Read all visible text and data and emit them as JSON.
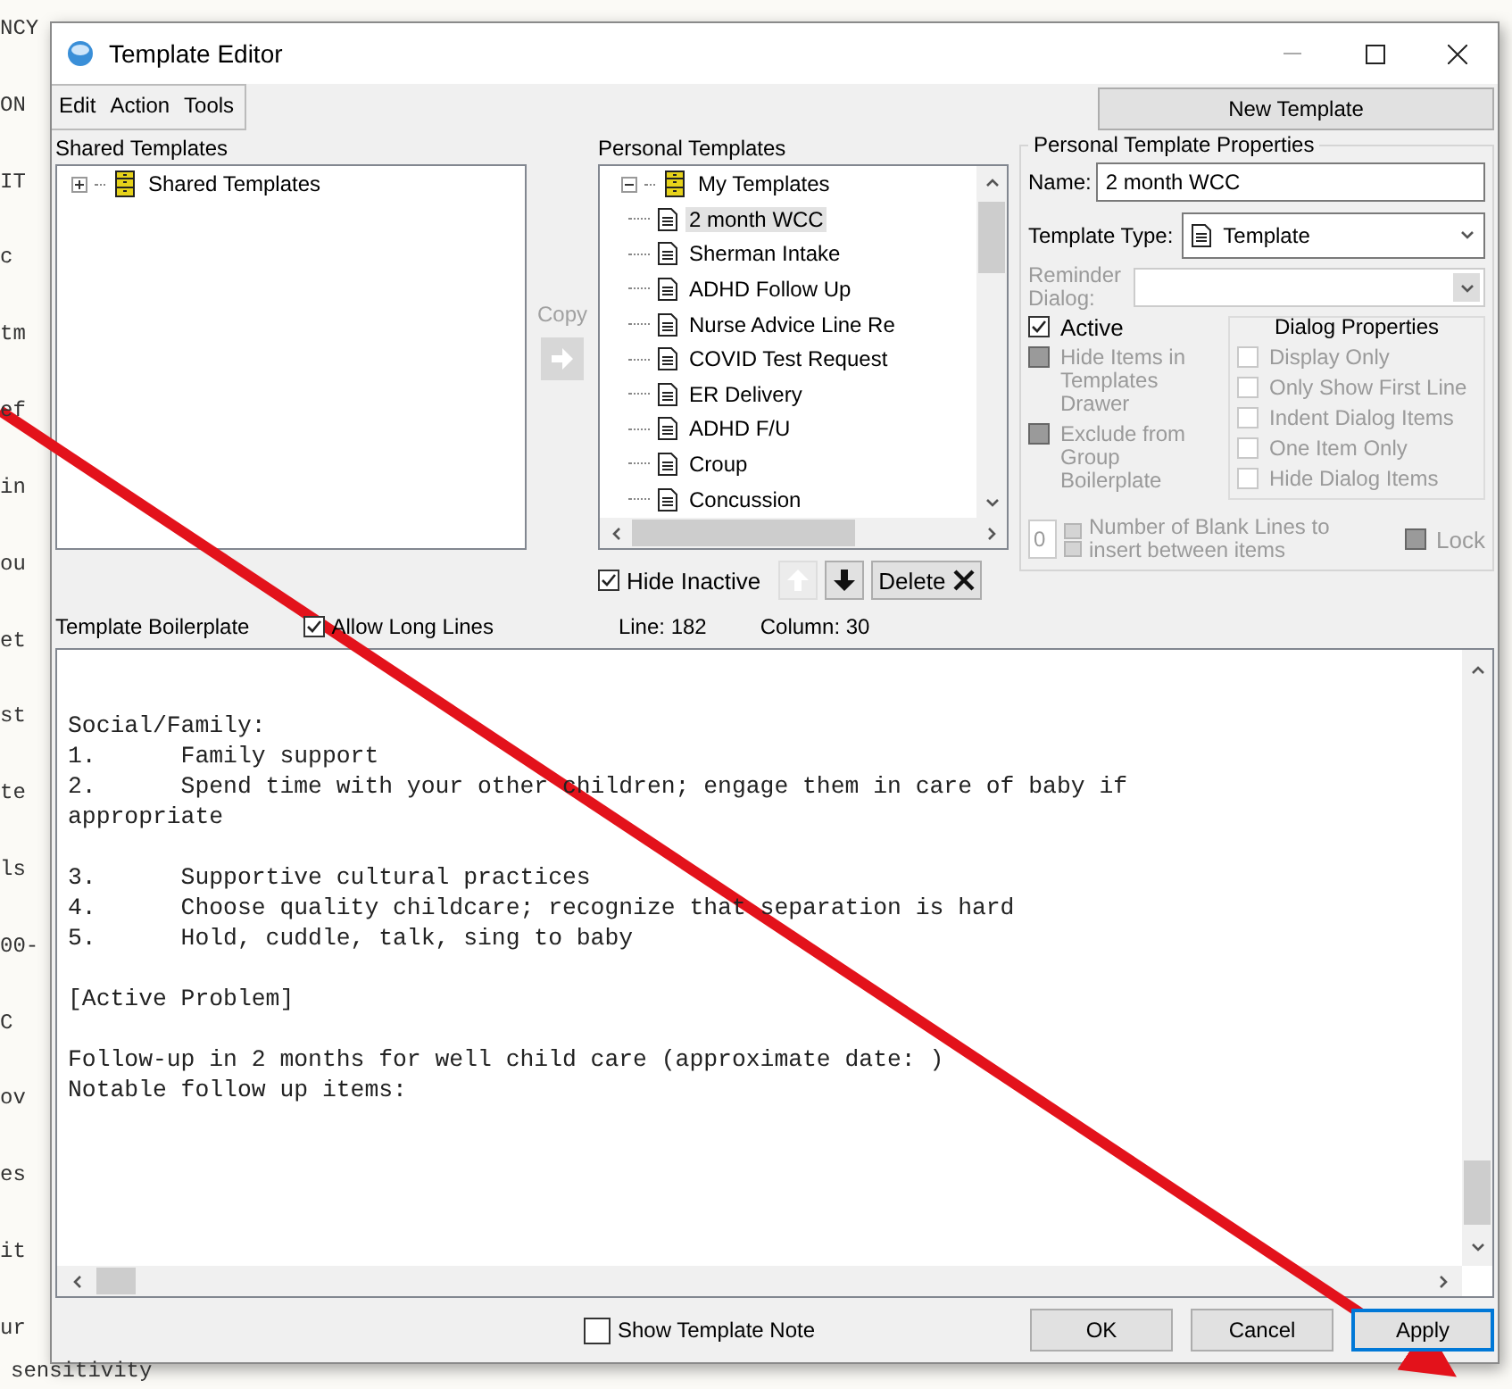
{
  "background_document": {
    "fragments": [
      "NCY",
      "ON",
      "IT",
      "c",
      "tm",
      "ef",
      "in",
      "ou",
      "et",
      "st",
      "te",
      "ls",
      "00-",
      "C",
      "ov",
      "es",
      "it",
      "ur"
    ],
    "last_line": "sensitivity"
  },
  "window": {
    "title": "Template Editor"
  },
  "menu": [
    "Edit",
    "Action",
    "Tools"
  ],
  "new_template_button": "New Template",
  "shared_templates": {
    "label": "Shared Templates",
    "tree": [
      {
        "label": "Shared Templates",
        "expanded": false
      }
    ]
  },
  "copy": {
    "label": "Copy",
    "disabled": true
  },
  "personal_templates": {
    "label": "Personal Templates",
    "tree": [
      {
        "label": "My Templates",
        "expanded": true,
        "children": [
          {
            "label": "2 month WCC",
            "selected": true
          },
          {
            "label": "Sherman Intake",
            "selected": false
          },
          {
            "label": "ADHD Follow Up",
            "selected": false
          },
          {
            "label": "Nurse Advice Line Re",
            "selected": false
          },
          {
            "label": "COVID Test Request",
            "selected": false
          },
          {
            "label": "ER Delivery",
            "selected": false
          },
          {
            "label": "ADHD F/U",
            "selected": false
          },
          {
            "label": "Croup",
            "selected": false
          },
          {
            "label": "Concussion",
            "selected": false
          }
        ]
      }
    ],
    "hide_inactive": {
      "label": "Hide Inactive",
      "checked": true
    },
    "move_up": {
      "disabled": true
    },
    "move_down": {
      "disabled": false
    },
    "delete_button": "Delete"
  },
  "properties": {
    "title": "Personal Template Properties",
    "name": {
      "label": "Name:",
      "value": "2 month WCC"
    },
    "template_type": {
      "label": "Template Type:",
      "value": "Template"
    },
    "reminder_dialog": {
      "label": "Reminder Dialog:",
      "disabled": true
    },
    "options": [
      {
        "label": "Active",
        "checked": true,
        "disabled": false
      },
      {
        "label": "Hide Items in Templates Drawer",
        "checked": false,
        "disabled": true
      },
      {
        "label": "Exclude from Group Boilerplate",
        "checked": false,
        "disabled": true
      }
    ],
    "dialog_properties": {
      "title": "Dialog Properties",
      "options": [
        {
          "label": "Display Only",
          "checked": false,
          "disabled": true
        },
        {
          "label": "Only Show First Line",
          "checked": false,
          "disabled": true
        },
        {
          "label": "Indent Dialog Items",
          "checked": false,
          "disabled": true
        },
        {
          "label": "One Item Only",
          "checked": false,
          "disabled": true
        },
        {
          "label": "Hide Dialog Items",
          "checked": false,
          "disabled": true
        }
      ]
    },
    "blank_lines": {
      "value": "0",
      "label": "Number of Blank Lines to insert between items",
      "disabled": true
    },
    "lock": {
      "label": "Lock",
      "checked": false,
      "disabled": true
    }
  },
  "boilerplate": {
    "label": "Template Boilerplate",
    "allow_long_lines": {
      "label": "Allow Long Lines",
      "checked": true
    },
    "line": "Line: 182",
    "column": "Column: 30",
    "paragraphs": [
      [
        "Social/Family:",
        "1.      Family support",
        "2.      Spend time with your other children; engage them in care of baby if",
        "appropriate"
      ],
      [
        "3.      Supportive cultural practices",
        "4.      Choose quality childcare; recognize that separation is hard",
        "5.      Hold, cuddle, talk, sing to baby"
      ],
      [
        "[Active Problem]"
      ],
      [
        "Follow-up in 2 months for well child care (approximate date: )",
        "Notable follow up items:"
      ]
    ]
  },
  "footer": {
    "show_template_note": {
      "label": "Show Template Note",
      "checked": false
    },
    "buttons": [
      {
        "label": "OK",
        "default": false
      },
      {
        "label": "Cancel",
        "default": false
      },
      {
        "label": "Apply",
        "default": true
      }
    ]
  }
}
